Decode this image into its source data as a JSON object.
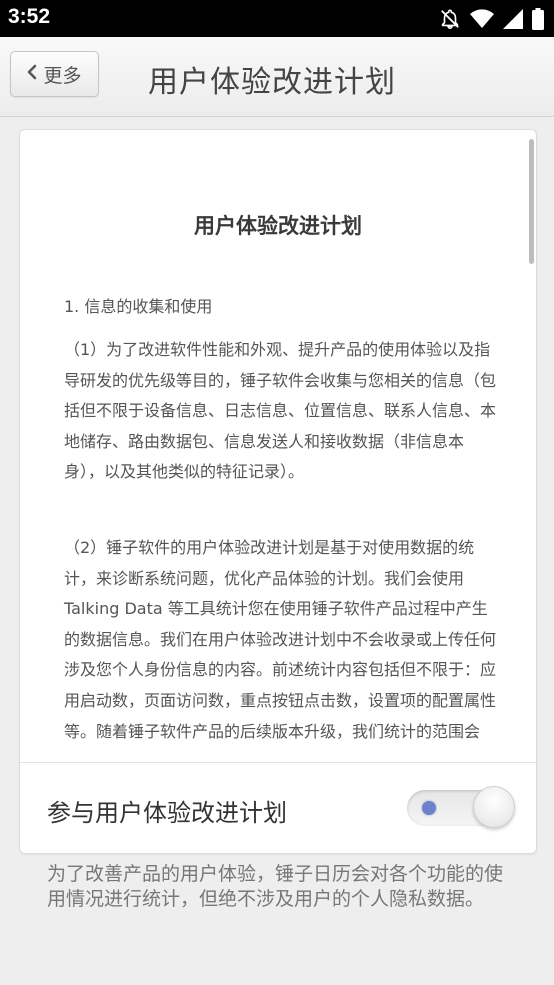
{
  "status_bar": {
    "time": "3:52",
    "icons": [
      "notifications-off-icon",
      "wifi-icon",
      "signal-icon",
      "battery-icon"
    ]
  },
  "header": {
    "back_label": "更多",
    "title": "用户体验改进计划"
  },
  "document": {
    "title": "用户体验改进计划",
    "section_heading": "1. 信息的收集和使用",
    "paragraphs": [
      "（1）为了改进软件性能和外观、提升产品的使用体验以及指导研发的优先级等目的，锤子软件会收集与您相关的信息（包括但不限于设备信息、日志信息、位置信息、联系人信息、本地储存、路由数据包、信息发送人和接收数据（非信息本身），以及其他类似的特征记录）。",
      "（2）锤子软件的用户体验改进计划是基于对使用数据的统计，来诊断系统问题，优化产品体验的计划。我们会使用 Talking Data 等工具统计您在使用锤子软件产品过程中产生的数据信息。我们在用户体验改进计划中不会收录或上传任何涉及您个人身份信息的内容。前述统计内容包括但不限于：应用启动数，页面访问数，重点按钮点击数，设置项的配置属性等。随着锤子软件产品的后续版本升级，我们统计的范围会"
    ]
  },
  "toggle": {
    "label": "参与用户体验改进计划",
    "state": "off",
    "indicator_color": "#6d83c9"
  },
  "footnote": "为了改善产品的用户体验，锤子日历会对各个功能的使用情况进行统计，但绝不涉及用户的个人隐私数据。",
  "colors": {
    "background": "#eeeeee",
    "card": "#ffffff",
    "status_bar": "#000000"
  }
}
